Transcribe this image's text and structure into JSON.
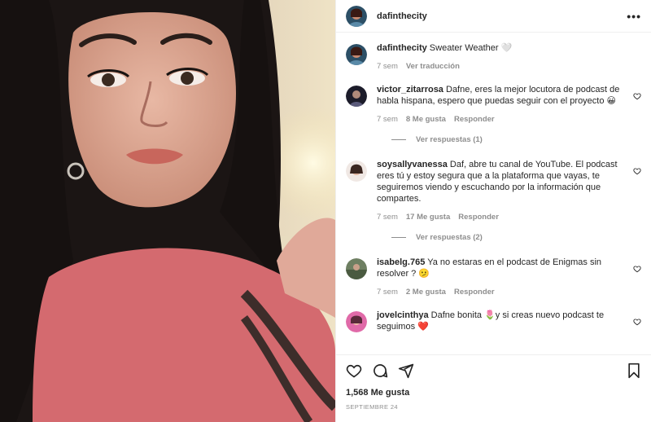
{
  "post": {
    "username": "dafinthecity",
    "caption_user": "dafinthecity",
    "caption_text": "Sweater Weather 🤍",
    "caption_age": "7 sem",
    "translate_label": "Ver traducción",
    "likes": "1,568 Me gusta",
    "date": "SEPTIEMBRE 24",
    "more_label": "•••"
  },
  "comments": [
    {
      "user": "victor_zitarrosa",
      "text": "Dafne, eres la mejor locutora de podcast de habla hispana, espero que puedas seguir con el proyecto 😀",
      "age": "7 sem",
      "likes": "8 Me gusta",
      "reply": "Responder",
      "replies": "Ver respuestas (1)"
    },
    {
      "user": "soysallyvanessa",
      "text": "Daf, abre tu canal de YouTube. El podcast eres tú y estoy segura que a la plataforma que vayas, te seguiremos viendo y escuchando por la información que compartes.",
      "age": "7 sem",
      "likes": "17 Me gusta",
      "reply": "Responder",
      "replies": "Ver respuestas (2)"
    },
    {
      "user": "isabelg.765",
      "text": "Ya no estaras en el podcast de Enigmas sin resolver ? 🫤",
      "age": "7 sem",
      "likes": "2 Me gusta",
      "reply": "Responder"
    },
    {
      "user": "jovelcinthya",
      "text": "Dafne bonita 🌷y si creas nuevo podcast te seguimos ❤️"
    }
  ],
  "icons": {
    "like": "heart-icon",
    "comment": "comment-icon",
    "share": "share-icon",
    "save": "bookmark-icon"
  }
}
